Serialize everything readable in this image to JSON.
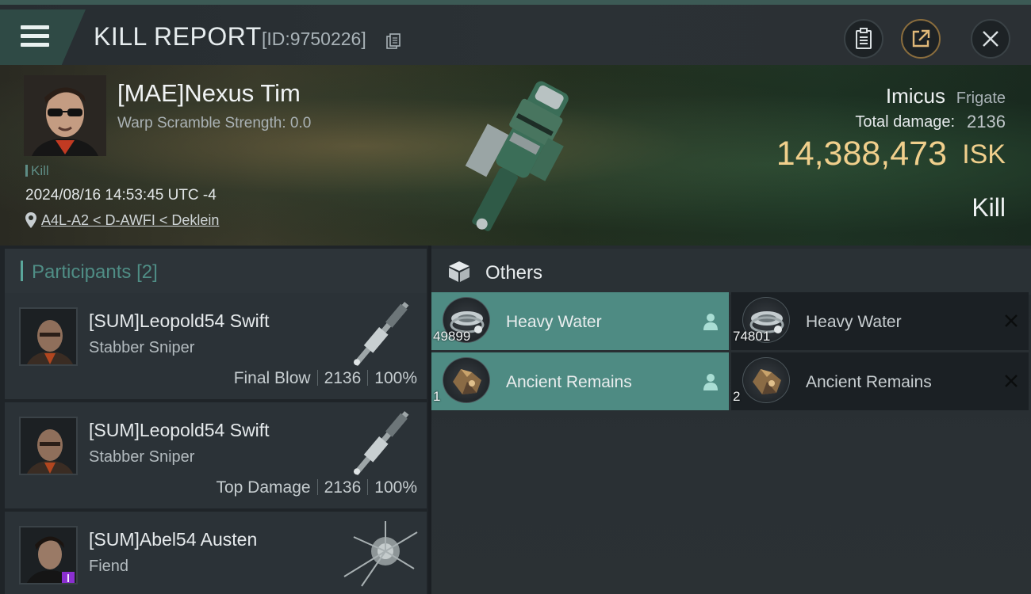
{
  "header": {
    "title": "KILL REPORT",
    "report_id": "[ID:9750226]"
  },
  "victim": {
    "name": "[MAE]Nexus Tim",
    "warp_scramble": "Warp Scramble Strength: 0.0",
    "tag": "Kill",
    "datetime": "2024/08/16 14:53:45 UTC -4",
    "location": "A4L-A2 < D-AWFI < Deklein"
  },
  "ship": {
    "name": "Imicus",
    "class": "Frigate",
    "total_damage_label": "Total damage:",
    "total_damage": "2136",
    "isk_value": "14,388,473",
    "isk_unit": "ISK",
    "result": "Kill"
  },
  "participants": {
    "label": "Participants",
    "count": "[2]",
    "rows": [
      {
        "name": "[SUM]Leopold54 Swift",
        "ship": "Stabber Sniper",
        "role": "Final Blow",
        "damage": "2136",
        "percent": "100%"
      },
      {
        "name": "[SUM]Leopold54 Swift",
        "ship": "Stabber Sniper",
        "role": "Top Damage",
        "damage": "2136",
        "percent": "100%"
      },
      {
        "name": "[SUM]Abel54 Austen",
        "ship": "Fiend"
      }
    ]
  },
  "others": {
    "label": "Others",
    "items": [
      {
        "name": "Heavy Water",
        "qty": "49899",
        "status": "dropped"
      },
      {
        "name": "Heavy Water",
        "qty": "74801",
        "status": "destroyed"
      },
      {
        "name": "Ancient Remains",
        "qty": "1",
        "status": "dropped"
      },
      {
        "name": "Ancient Remains",
        "qty": "2",
        "status": "destroyed"
      }
    ]
  },
  "colors": {
    "accent_teal": "#4e8b83",
    "isk_gold": "#f0cf8c",
    "background": "#1b1f23"
  },
  "icons": [
    "menu-icon",
    "copy-icon",
    "clipboard-icon",
    "share-icon",
    "close-icon",
    "location-pin-icon",
    "box-icon",
    "person-icon",
    "x-icon"
  ]
}
